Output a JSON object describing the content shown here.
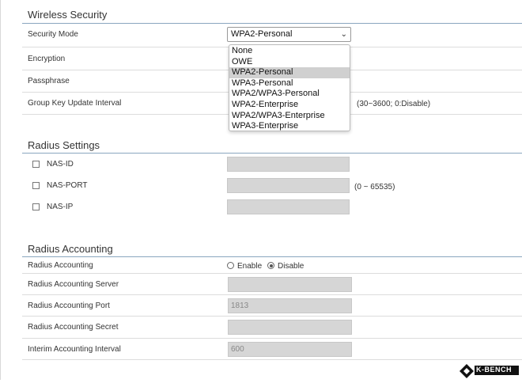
{
  "wireless_security": {
    "title": "Wireless Security",
    "security_mode_label": "Security Mode",
    "security_mode_value": "WPA2-Personal",
    "encryption_label": "Encryption",
    "passphrase_label": "Passphrase",
    "group_key_label": "Group Key Update Interval",
    "group_key_hint": "(30~3600; 0:Disable)",
    "dropdown_options": [
      "None",
      "OWE",
      "WPA2-Personal",
      "WPA3-Personal",
      "WPA2/WPA3-Personal",
      "WPA2-Enterprise",
      "WPA2/WPA3-Enterprise",
      "WPA3-Enterprise"
    ],
    "selected_option": "WPA2-Personal"
  },
  "radius_settings": {
    "title": "Radius Settings",
    "nas_id_label": "NAS-ID",
    "nas_port_label": "NAS-PORT",
    "nas_port_hint": "(0 ~ 65535)",
    "nas_ip_label": "NAS-IP"
  },
  "radius_accounting": {
    "title": "Radius Accounting",
    "accounting_label": "Radius Accounting",
    "enable_label": "Enable",
    "disable_label": "Disable",
    "selected": "Disable",
    "server_label": "Radius Accounting Server",
    "port_label": "Radius Accounting Port",
    "port_value": "1813",
    "secret_label": "Radius Accounting Secret",
    "interim_label": "Interim Accounting Interval",
    "interim_value": "600"
  },
  "logo": {
    "brand": "K-BENCH",
    "icon": "kbench-logo-icon"
  },
  "colors": {
    "section_line": "#8aa6bf",
    "disabled_field": "#d6d6d6",
    "selected_option_bg": "#d0d0d0"
  }
}
